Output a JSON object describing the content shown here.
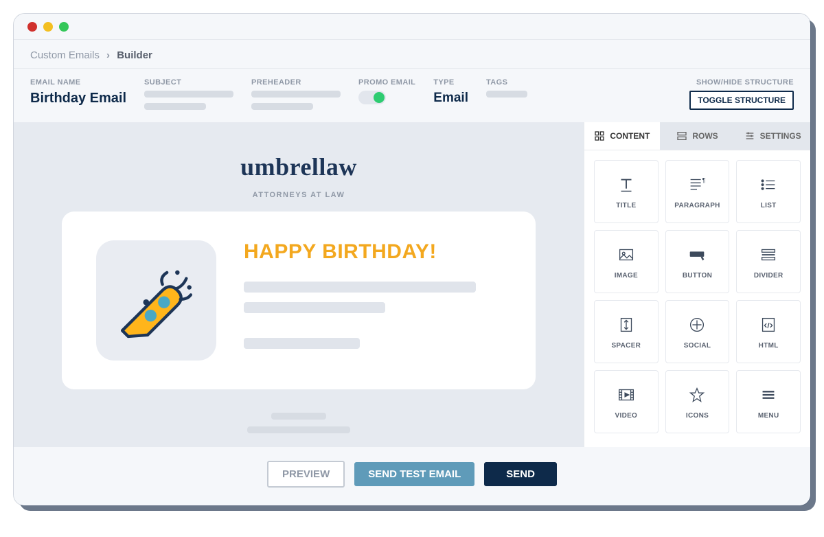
{
  "breadcrumb": {
    "root": "Custom Emails",
    "current": "Builder"
  },
  "props": {
    "email_name_label": "EMAIL NAME",
    "email_name_value": "Birthday Email",
    "subject_label": "SUBJECT",
    "preheader_label": "PREHEADER",
    "promo_label": "PROMO EMAIL",
    "type_label": "TYPE",
    "type_value": "Email",
    "tags_label": "TAGS",
    "structure_label": "SHOW/HIDE STRUCTURE",
    "toggle_structure_btn": "TOGGLE STRUCTURE"
  },
  "canvas": {
    "brand": "umbrellaw",
    "brand_sub": "ATTORNEYS AT LAW",
    "headline": "HAPPY BIRTHDAY!"
  },
  "sidepanel": {
    "tabs": {
      "content": "CONTENT",
      "rows": "ROWS",
      "settings": "SETTINGS"
    },
    "blocks": {
      "title": "TITLE",
      "paragraph": "PARAGRAPH",
      "list": "LIST",
      "image": "IMAGE",
      "button": "BUTTON",
      "divider": "DIVIDER",
      "spacer": "SPACER",
      "social": "SOCIAL",
      "html": "HTML",
      "video": "VIDEO",
      "icons": "ICONS",
      "menu": "MENU"
    }
  },
  "actions": {
    "preview": "PREVIEW",
    "send_test": "SEND TEST EMAIL",
    "send": "SEND"
  }
}
